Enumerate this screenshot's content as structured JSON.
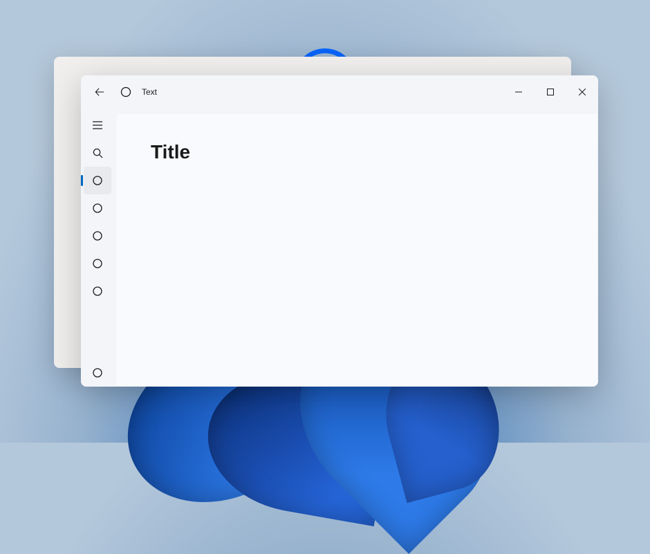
{
  "window": {
    "title": "Text"
  },
  "page": {
    "heading": "Title"
  },
  "sidebar": {
    "selected_index": 0
  }
}
